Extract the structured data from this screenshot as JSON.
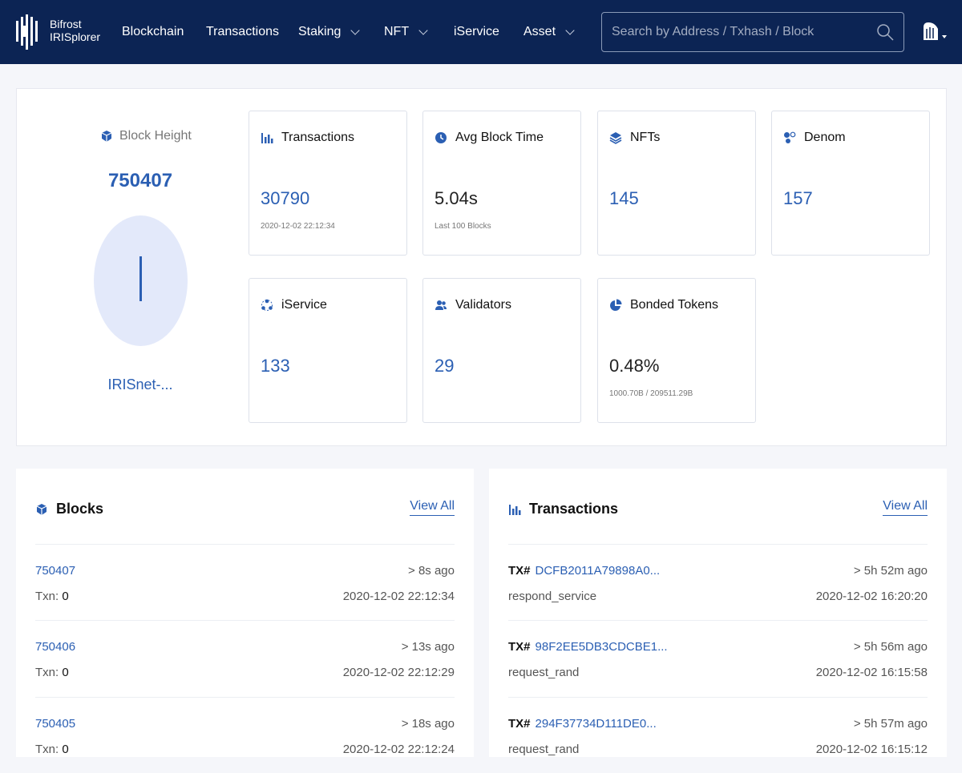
{
  "header": {
    "brand_line1": "Bifrost",
    "brand_line2": "IRISplorer",
    "nav": [
      {
        "label": "Blockchain",
        "dropdown": false
      },
      {
        "label": "Transactions",
        "dropdown": false
      },
      {
        "label": "Staking",
        "dropdown": true
      },
      {
        "label": "NFT",
        "dropdown": true
      },
      {
        "label": "iService",
        "dropdown": false
      },
      {
        "label": "Asset",
        "dropdown": true
      }
    ],
    "search_placeholder": "Search by Address / Txhash / Block"
  },
  "overview": {
    "block_height_label": "Block Height",
    "block_height": "750407",
    "avatar_initial": "I",
    "chain_name": "IRISnet-...",
    "cards": [
      {
        "key": "transactions",
        "label": "Transactions",
        "value": "30790",
        "sub": "2020-12-02 22:12:34"
      },
      {
        "key": "avg_block_time",
        "label": "Avg Block Time",
        "value": "5.04s",
        "sub": "Last 100 Blocks"
      },
      {
        "key": "nfts",
        "label": "NFTs",
        "value": "145",
        "sub": ""
      },
      {
        "key": "denom",
        "label": "Denom",
        "value": "157",
        "sub": ""
      },
      {
        "key": "iservice",
        "label": "iService",
        "value": "133",
        "sub": ""
      },
      {
        "key": "validators",
        "label": "Validators",
        "value": "29",
        "sub": ""
      },
      {
        "key": "bonded_tokens",
        "label": "Bonded Tokens",
        "value": "0.48%",
        "sub": "1000.70B / 209511.29B"
      }
    ]
  },
  "blocks": {
    "title": "Blocks",
    "view_all": "View All",
    "txn_prefix": "Txn: ",
    "rows": [
      {
        "height": "750407",
        "age": "> 8s ago",
        "txn": "0",
        "time": "2020-12-02 22:12:34"
      },
      {
        "height": "750406",
        "age": "> 13s ago",
        "txn": "0",
        "time": "2020-12-02 22:12:29"
      },
      {
        "height": "750405",
        "age": "> 18s ago",
        "txn": "0",
        "time": "2020-12-02 22:12:24"
      }
    ]
  },
  "transactions": {
    "title": "Transactions",
    "view_all": "View All",
    "tx_prefix": "TX#",
    "rows": [
      {
        "hash": "DCFB2011A79898A0...",
        "age": "> 5h 52m ago",
        "type": "respond_service",
        "time": "2020-12-02 16:20:20"
      },
      {
        "hash": "98F2EE5DB3CDCBE1...",
        "age": "> 5h 56m ago",
        "type": "request_rand",
        "time": "2020-12-02 16:15:58"
      },
      {
        "hash": "294F37734D111DE0...",
        "age": "> 5h 57m ago",
        "type": "request_rand",
        "time": "2020-12-02 16:15:12"
      }
    ]
  },
  "colors": {
    "header_bg": "#0c2454",
    "accent": "#2b5fb3",
    "avatar_bg": "#e3e9fa"
  },
  "icons": [
    "logo-icon",
    "search-icon",
    "network-switch-icon",
    "cube-icon",
    "bar-chart-icon",
    "clock-icon",
    "layers-icon",
    "denom-icon",
    "iservice-icon",
    "validators-icon",
    "pie-icon"
  ]
}
